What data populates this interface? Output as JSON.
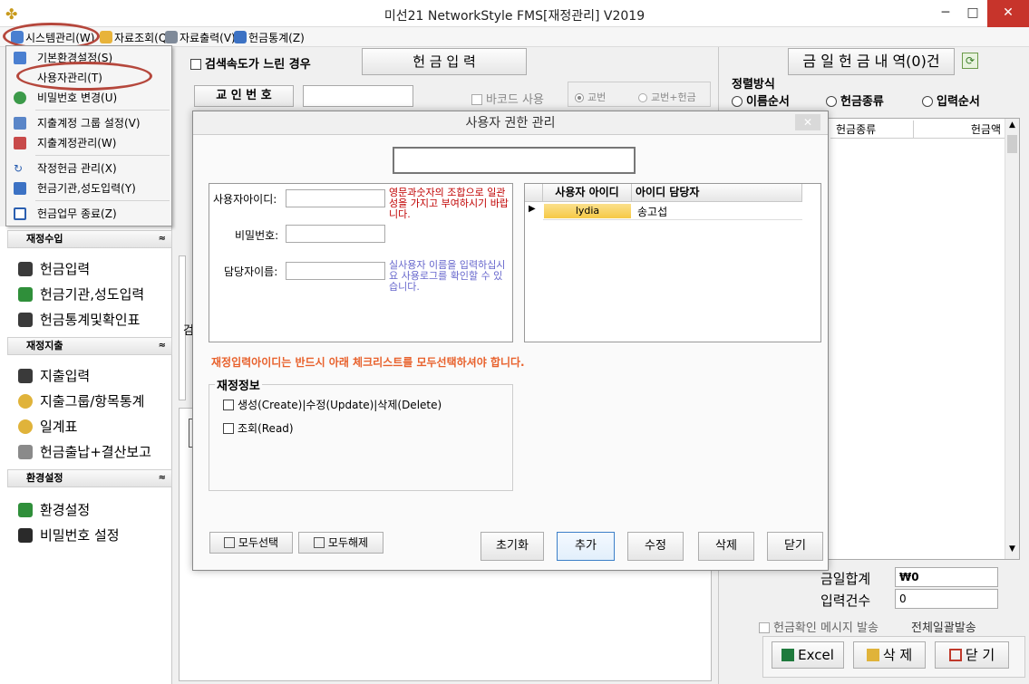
{
  "window": {
    "title": "미선21 NetworkStyle FMS[재정관리] V2019",
    "minimize": "─",
    "maximize": "□",
    "close": "✕"
  },
  "menubar": {
    "items": [
      "시스템관리(W)",
      "자료조회(Q)",
      "자료출력(V)",
      "헌금통계(Z)"
    ]
  },
  "dropdown": {
    "items": [
      "기본환경설정(S)",
      "사용자관리(T)",
      "비밀번호 변경(U)",
      "지출계정 그룹 설정(V)",
      "지출계정관리(W)",
      "작정헌금 관리(X)",
      "헌금기관,성도입력(Y)",
      "헌금업무 종료(Z)"
    ]
  },
  "sidebar": {
    "sections": [
      {
        "title": "재정수입",
        "items": [
          "헌금입력",
          "헌금기관,성도입력",
          "헌금통계및확인표"
        ]
      },
      {
        "title": "재정지출",
        "items": [
          "지출입력",
          "지출그룹/항목통계",
          "일계표",
          "헌금출납+결산보고"
        ]
      },
      {
        "title": "환경설정",
        "items": [
          "환경설정",
          "비밀번호 설정"
        ]
      }
    ],
    "collapse": "≈"
  },
  "main": {
    "slow_search_label": "검색속도가 느린 경우",
    "tab_label": "헌 금 입 력",
    "receipt_button": "교 인 번 호",
    "barcode_label": "바코드 사용",
    "radio_a": "교번",
    "radio_b": "교번+헌금",
    "partial_label": "검"
  },
  "right": {
    "header": "금 일 헌 금 내 역(0)건",
    "sort_label": "정렬방식",
    "sort_options": [
      "이름순서",
      "헌금종류",
      "입력순서"
    ],
    "col_type": "헌금종류",
    "col_amount": "헌금액",
    "total_label": "금일합계",
    "total_value": "₩0",
    "count_label": "입력건수",
    "count_value": "0",
    "confirm_label": "헌금확인 메시지 발송",
    "bulk_label": "전체일괄발송",
    "excel_btn": "Excel",
    "delete_btn": "삭 제",
    "close_btn": "닫 기"
  },
  "dialog": {
    "title": "사용자 권한 관리",
    "close": "✕",
    "user_id_label": "사용자아이디:",
    "user_id_hint": "영문과숫자의 조합으로 일관성을 가지고 부여하시기 바랍니다.",
    "password_label": "비밀번호:",
    "manager_label": "담당자이름:",
    "manager_hint": "실사용자 이름을 입력하십시요 사용로그를 확인할 수 있습니다.",
    "grid": {
      "col_id": "사용자 아이디",
      "col_manager": "아이디 담당자",
      "rows": [
        {
          "id": "lydia",
          "manager": "송고섭"
        }
      ]
    },
    "warning": "재정입력아이디는 반드시 아래 체크리스트를 모두선택하셔야 합니다.",
    "group_title": "재정정보",
    "check_1": "생성(Create)|수정(Update)|삭제(Delete)",
    "check_2": "조회(Read)",
    "btn_select_all": "모두선택",
    "btn_deselect_all": "모두해제",
    "btn_reset": "초기화",
    "btn_add": "추가",
    "btn_edit": "수정",
    "btn_delete": "삭제",
    "btn_close": "닫기"
  },
  "colors": {
    "accent": "#b5473c",
    "warning": "#e8612c",
    "hint_red": "#c00000",
    "hint_blue": "#6666cc",
    "selected_cell": "#f6c945"
  }
}
